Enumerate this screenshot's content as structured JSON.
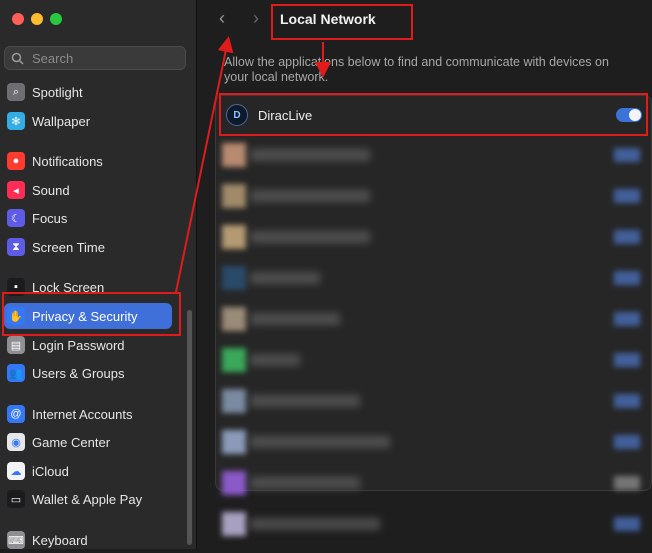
{
  "sidebar": {
    "search_placeholder": "Search",
    "items": [
      {
        "label": "Spotlight",
        "icon": "magnifier-icon",
        "color": "#6e6e73",
        "glyph": "⌕"
      },
      {
        "label": "Wallpaper",
        "icon": "snowflake-icon",
        "color": "#32ade6",
        "glyph": "✻"
      },
      {
        "label": "Notifications",
        "icon": "bell-icon",
        "color": "#ff3b30",
        "glyph": "●"
      },
      {
        "label": "Sound",
        "icon": "speaker-icon",
        "color": "#ff2d55",
        "glyph": "◂"
      },
      {
        "label": "Focus",
        "icon": "moon-icon",
        "color": "#5e5ce6",
        "glyph": "☾"
      },
      {
        "label": "Screen Time",
        "icon": "hourglass-icon",
        "color": "#5e5ce6",
        "glyph": "⧗"
      },
      {
        "label": "Lock Screen",
        "icon": "lock-icon",
        "color": "#1c1c1e",
        "glyph": "▪"
      },
      {
        "label": "Privacy & Security",
        "icon": "hand-icon",
        "color": "#3478f6",
        "glyph": "✋"
      },
      {
        "label": "Login Password",
        "icon": "key-icon",
        "color": "#8e8e93",
        "glyph": "▤"
      },
      {
        "label": "Users & Groups",
        "icon": "users-icon",
        "color": "#3478f6",
        "glyph": "👥"
      },
      {
        "label": "Internet Accounts",
        "icon": "at-icon",
        "color": "#3478f6",
        "glyph": "@"
      },
      {
        "label": "Game Center",
        "icon": "game-center-icon",
        "color": "#e5e5ea",
        "glyph": "◉"
      },
      {
        "label": "iCloud",
        "icon": "cloud-icon",
        "color": "#f2f2f7",
        "glyph": "☁"
      },
      {
        "label": "Wallet & Apple Pay",
        "icon": "wallet-icon",
        "color": "#1c1c1e",
        "glyph": "▭"
      },
      {
        "label": "Keyboard",
        "icon": "keyboard-icon",
        "color": "#8e8e93",
        "glyph": "⌨"
      }
    ]
  },
  "header": {
    "back_glyph": "‹",
    "forward_glyph": "›",
    "title": "Local Network"
  },
  "main": {
    "description": "Allow the applications below to find and communicate with devices on your local network.",
    "first_app": {
      "name": "DiracLive",
      "icon_text": "D",
      "enabled": true
    },
    "blurred_icon_colors": [
      "#b88a70",
      "#a08a6a",
      "#b49a72",
      "#2a4a6a",
      "#9a8a78",
      "#3aa85a",
      "#7a8aa0",
      "#8a9ab8",
      "#8a5ac8",
      "#a8a0c0"
    ]
  },
  "colors": {
    "accent": "#3b73d9",
    "highlight": "#e01b1b"
  }
}
